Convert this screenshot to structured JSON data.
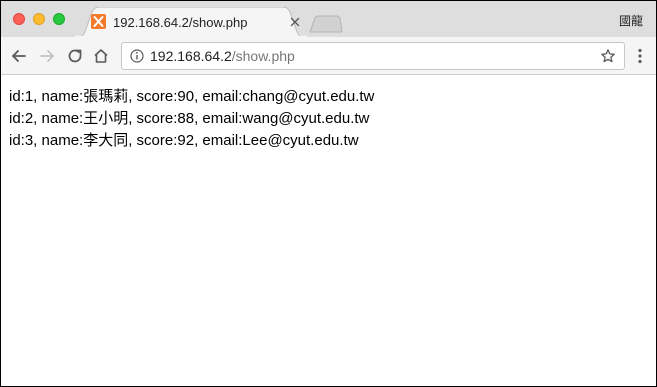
{
  "window": {
    "profile_label": "國龍"
  },
  "tab": {
    "title": "192.168.64.2/show.php",
    "favicon": "xampp-icon",
    "favicon_color": "#f5792a"
  },
  "toolbar": {
    "url_host": "192.168.64.2",
    "url_path": "/show.php"
  },
  "content": {
    "rows": [
      "id:1, name:張瑪莉, score:90, email:chang@cyut.edu.tw",
      "id:2, name:王小明, score:88, email:wang@cyut.edu.tw",
      "id:3, name:李大同, score:92, email:Lee@cyut.edu.tw"
    ]
  }
}
